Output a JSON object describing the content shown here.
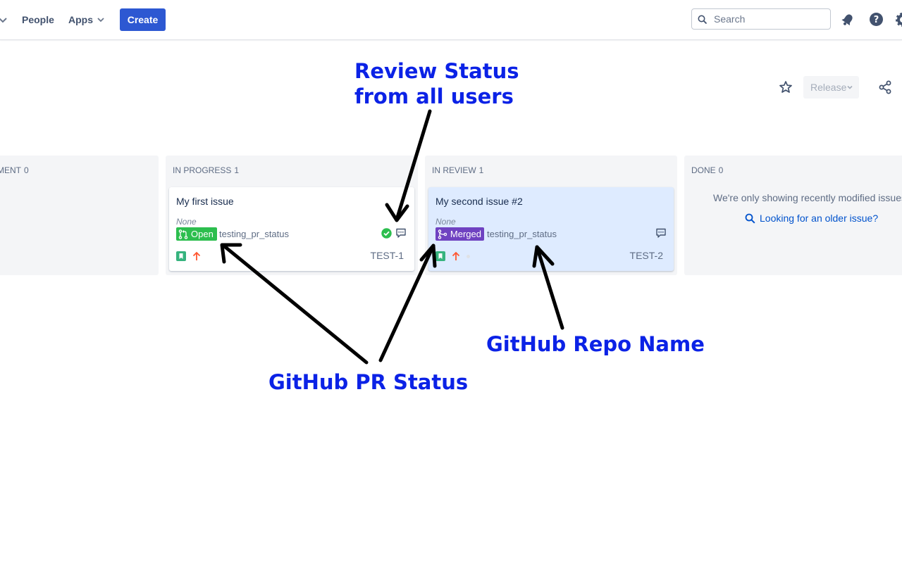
{
  "nav": {
    "people": "People",
    "apps": "Apps",
    "create": "Create",
    "search_placeholder": "Search",
    "icons": [
      "chevron-down-icon",
      "search-icon",
      "bell-icon",
      "help-icon",
      "gear-icon"
    ]
  },
  "header_actions": {
    "release": "Release",
    "icons": [
      "star-icon",
      "share-icon"
    ]
  },
  "board": {
    "columns": [
      {
        "name": "PMENT",
        "count": "0"
      },
      {
        "name": "IN PROGRESS",
        "count": "1"
      },
      {
        "name": "IN REVIEW",
        "count": "1"
      },
      {
        "name": "DONE",
        "count": "0"
      }
    ],
    "cards": [
      {
        "title": "My first issue",
        "field_value": "None",
        "pr_status": "Open",
        "repo": "testing_pr_status",
        "key": "TEST-1",
        "review_status": "approved"
      },
      {
        "title": "My second issue #2",
        "field_value": "None",
        "pr_status": "Merged",
        "repo": "testing_pr_status",
        "key": "TEST-2"
      }
    ],
    "done_message": "We're only showing recently modified issues",
    "done_link": "Looking for an older issue?"
  },
  "annotations": {
    "review_status_line1": "Review Status",
    "review_status_line2": "from all users",
    "pr_status": "GitHub PR Status",
    "repo_name": "GitHub Repo Name"
  },
  "colors": {
    "primary_button": "#2d58d2",
    "pr_open": "#2cbe4e",
    "pr_merged": "#6f42c1",
    "selected_card": "#deebff",
    "annotation": "#0b22e6"
  }
}
